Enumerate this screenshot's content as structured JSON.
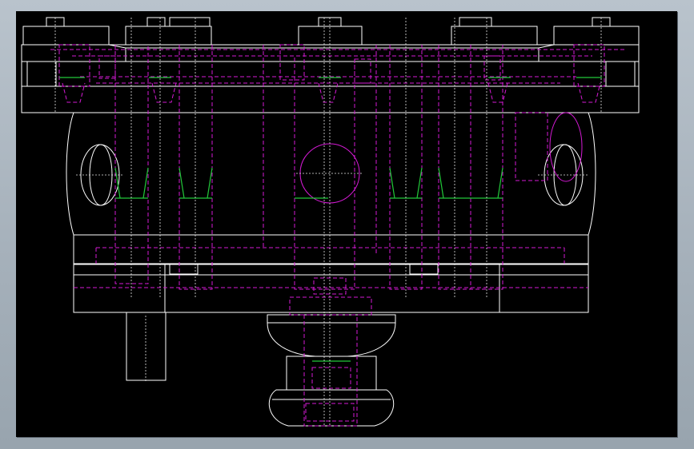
{
  "view": {
    "background": "#000000",
    "frame_color": "#ffffff",
    "hidden_line_color": "#d41ad4",
    "thread_color": "#22c83a",
    "centerline_color": "#e6e6e6"
  },
  "icons": {
    "hidden_edges": "dashed-lines",
    "center_marks": "dotted-lines",
    "thread_marks": "green-lines"
  }
}
